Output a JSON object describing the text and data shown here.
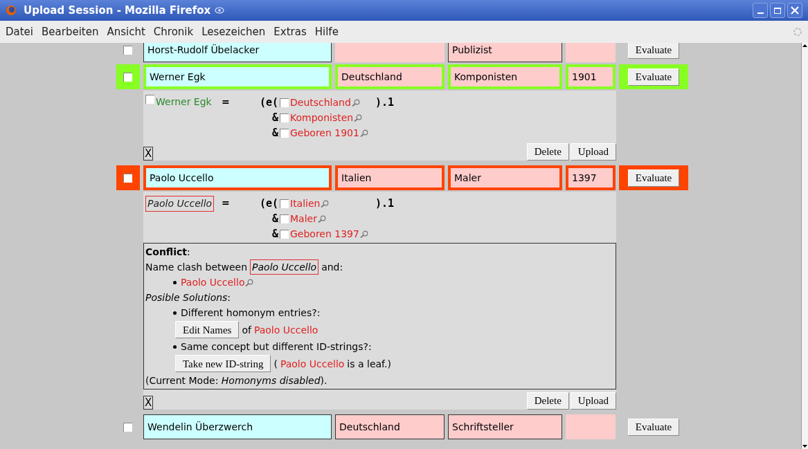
{
  "window": {
    "title": "Upload Session - Mozilla Firefox"
  },
  "menu": [
    "Datei",
    "Bearbeiten",
    "Ansicht",
    "Chronik",
    "Lesezeichen",
    "Extras",
    "Hilfe"
  ],
  "rows": [
    {
      "kind": "plain",
      "checked": false,
      "cells": [
        {
          "text": "Horst-Rudolf Übelacker",
          "outlined": true
        },
        {
          "outlined": false
        },
        {
          "text": "Publizist",
          "outlined": true
        },
        {
          "outlined": false
        }
      ],
      "button": "Evaluate"
    },
    {
      "kind": "ok",
      "checked": false,
      "cells": [
        {
          "text": "Werner Egk"
        },
        {
          "text": "Deutschland"
        },
        {
          "text": "Komponisten"
        },
        {
          "text": "1901"
        }
      ],
      "button": "Evaluate",
      "detail": {
        "head": {
          "text": "Werner Egk",
          "kind": "ok",
          "checked": false
        },
        "equals": "=",
        "open": "(e(",
        "close": ").1",
        "terms": [
          {
            "label": "Deutschland",
            "checked": false
          },
          {
            "joiner": "&",
            "label": "Komponisten",
            "checked": false
          },
          {
            "joiner": "&",
            "label": "Geboren 1901",
            "checked": false
          }
        ],
        "close_button": "X",
        "actions": [
          "Delete",
          "Upload"
        ]
      }
    },
    {
      "kind": "conflict",
      "checked": false,
      "cells": [
        {
          "text": "Paolo Uccello"
        },
        {
          "text": "Italien"
        },
        {
          "text": "Maler"
        },
        {
          "text": "1397"
        }
      ],
      "button": "Evaluate",
      "detail": {
        "head": {
          "text": "Paolo Uccello",
          "kind": "conflict"
        },
        "equals": "=",
        "open": "(e(",
        "close": ").1",
        "terms": [
          {
            "label": "Italien",
            "checked": false
          },
          {
            "joiner": "&",
            "label": "Maler",
            "checked": false
          },
          {
            "joiner": "&",
            "label": "Geboren 1397",
            "checked": false
          }
        ],
        "conflict": {
          "title": "**Conflict**:",
          "clash_before": "Name clash between",
          "clash_name": "Paolo Uccello",
          "clash_after": "and:",
          "clashes": [
            "Paolo Uccello"
          ],
          "solutions_title": "*Posible Solutions*:",
          "solutions": [
            {
              "question": "Different homonym entries?:",
              "button": "Edit Names",
              "before": "of",
              "name": "Paolo Uccello"
            },
            {
              "question": "Same concept but different ID-strings?:",
              "button": "Take new ID-string",
              "before": "(",
              "name": "Paolo Uccello",
              "after": "is a leaf.)"
            }
          ],
          "mode": "(Current Mode: *Homonyms disabled*)."
        },
        "close_button": "X",
        "actions": [
          "Delete",
          "Upload"
        ]
      }
    },
    {
      "kind": "plain",
      "checked": false,
      "cells": [
        {
          "text": "Wendelin Überzwerch",
          "outlined": true
        },
        {
          "text": "Deutschland",
          "outlined": true
        },
        {
          "text": "Schriftsteller",
          "outlined": true
        },
        {
          "outlined": false
        }
      ],
      "button": "Evaluate"
    }
  ]
}
